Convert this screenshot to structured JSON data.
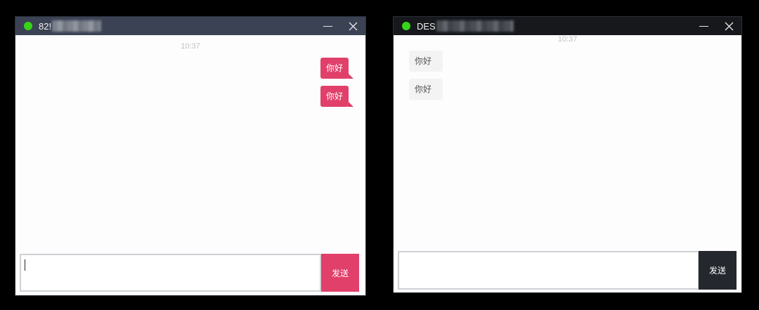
{
  "colors": {
    "accent_pink": "#e0406a",
    "online_green": "#37d419",
    "dark_button": "#24272d"
  },
  "left_window": {
    "title": "82!",
    "status": "online",
    "timestamp": "10:37",
    "messages": [
      {
        "direction": "sent",
        "text": "你好"
      },
      {
        "direction": "sent",
        "text": "你好"
      }
    ],
    "input_value": "",
    "send_label": "发送"
  },
  "right_window": {
    "title": "DES",
    "status": "online",
    "timestamp": "10:37",
    "messages": [
      {
        "direction": "received",
        "text": "你好"
      },
      {
        "direction": "received",
        "text": "你好"
      }
    ],
    "input_value": "",
    "send_label": "发送"
  }
}
